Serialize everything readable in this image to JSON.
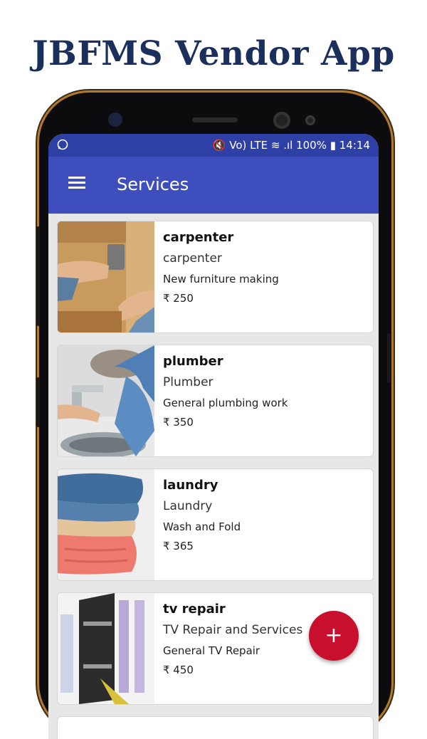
{
  "promo": {
    "title": "JBFMS Vendor App"
  },
  "status_bar": {
    "left_icon": "whatsapp-icon",
    "indicators": "🔇 Vo) LTE ≋ .ıl",
    "battery": "100% ▮",
    "time": "14:14"
  },
  "app_bar": {
    "menu_icon": "hamburger-menu-icon",
    "title": "Services"
  },
  "services": [
    {
      "name": "carpenter",
      "category": "carpenter",
      "description": "New furniture making",
      "price": "₹ 250",
      "image": "carpenter-photo"
    },
    {
      "name": "plumber",
      "category": "Plumber",
      "description": "General plumbing work",
      "price": "₹ 350",
      "image": "plumber-photo"
    },
    {
      "name": "laundry",
      "category": "Laundry",
      "description": "Wash and Fold",
      "price": "₹ 365",
      "image": "laundry-photo"
    },
    {
      "name": "tv repair",
      "category": "TV Repair and Services",
      "description": "General TV Repair",
      "price": "₹ 450",
      "image": "tv-repair-photo"
    }
  ],
  "fab": {
    "label": "+",
    "icon": "add-icon"
  },
  "colors": {
    "app_bar": "#3e4fbd",
    "status_bar": "#2e3fa6",
    "fab": "#c8102e",
    "title": "#1b2f5c"
  }
}
